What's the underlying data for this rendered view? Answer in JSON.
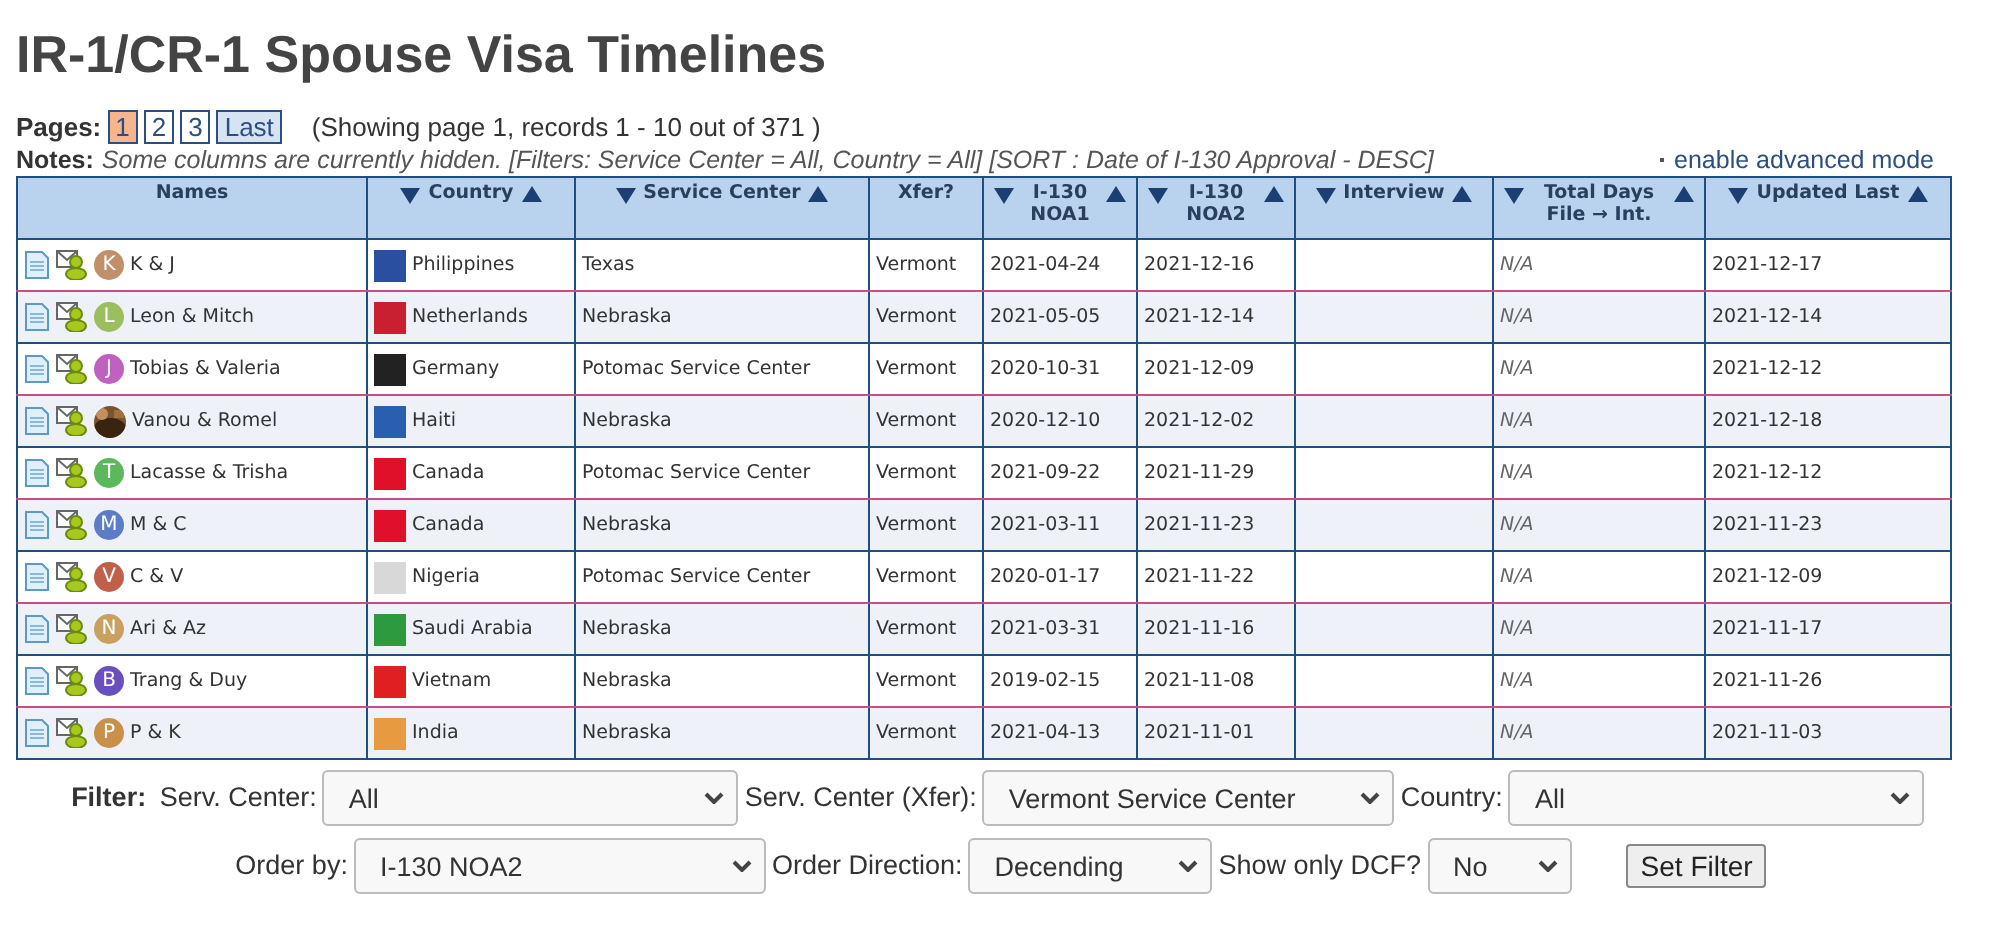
{
  "title": "IR-1/CR-1 Spouse Visa Timelines",
  "pager": {
    "label": "Pages:",
    "pages": [
      {
        "label": "1",
        "selected": true
      },
      {
        "label": "2",
        "selected": false
      },
      {
        "label": "3",
        "selected": false
      },
      {
        "label": "Last",
        "selected": false
      }
    ],
    "summary": "(Showing page 1, records 1 - 10 out of 371 )"
  },
  "notes": {
    "label": "Notes:",
    "text": "Some columns are currently hidden. [Filters: Service Center = All, Country = All] [SORT : Date of I-130 Approval - DESC]",
    "link": "enable advanced mode"
  },
  "table": {
    "columns": [
      {
        "label": "Names",
        "kind": "plain"
      },
      {
        "label": "Country",
        "kind": "sortable"
      },
      {
        "label": "Service Center",
        "kind": "sortable"
      },
      {
        "label": "Xfer?",
        "kind": "plain"
      },
      {
        "label": "I-130 NOA1",
        "kind": "sortable"
      },
      {
        "label": "I-130 NOA2",
        "kind": "sortable"
      },
      {
        "label": "Interview",
        "kind": "sortable"
      },
      {
        "label": "Total Days File → Int.",
        "kind": "sortable"
      },
      {
        "label": "Updated Last",
        "kind": "sortable"
      }
    ],
    "rows": [
      {
        "avatar": {
          "kind": "letter",
          "letter": "K",
          "color": "#c0906a"
        },
        "names": "K & J",
        "flag": {
          "color": "#2a4fa0"
        },
        "country": "Philippines",
        "service_center": "Texas",
        "xfer": "Vermont",
        "noa1": "2021-04-24",
        "noa2": "2021-12-16",
        "total_days": "N/A",
        "updated": "2021-12-17"
      },
      {
        "avatar": {
          "kind": "letter",
          "letter": "L",
          "color": "#9cbf5e"
        },
        "names": "Leon & Mitch",
        "flag": {
          "color": "#c8202f"
        },
        "country": "Netherlands",
        "service_center": "Nebraska",
        "xfer": "Vermont",
        "noa1": "2021-05-05",
        "noa2": "2021-12-14",
        "total_days": "N/A",
        "updated": "2021-12-14"
      },
      {
        "avatar": {
          "kind": "letter",
          "letter": "J",
          "color": "#c060c0"
        },
        "names": "Tobias & Valeria",
        "flag": {
          "color": "#222222"
        },
        "country": "Germany",
        "service_center": "Potomac Service Center",
        "xfer": "Vermont",
        "noa1": "2020-10-31",
        "noa2": "2021-12-09",
        "total_days": "N/A",
        "updated": "2021-12-12"
      },
      {
        "names": "Vanou & Romel",
        "flag": {
          "color": "#2a5fb0"
        },
        "country": "Haiti",
        "service_center": "Nebraska",
        "xfer": "Vermont",
        "noa1": "2020-12-10",
        "noa2": "2021-12-02",
        "total_days": "N/A",
        "updated": "2021-12-18"
      },
      {
        "avatar": {
          "kind": "letter",
          "letter": "T",
          "color": "#5cb85c"
        },
        "names": "Lacasse & Trisha",
        "flag": {
          "color": "#e0102a"
        },
        "country": "Canada",
        "service_center": "Potomac Service Center",
        "xfer": "Vermont",
        "noa1": "2021-09-22",
        "noa2": "2021-11-29",
        "total_days": "N/A",
        "updated": "2021-12-12"
      },
      {
        "avatar": {
          "kind": "letter",
          "letter": "M",
          "color": "#5b7cc8"
        },
        "names": "M & C",
        "flag": {
          "color": "#e0102a"
        },
        "country": "Canada",
        "service_center": "Nebraska",
        "xfer": "Vermont",
        "noa1": "2021-03-11",
        "noa2": "2021-11-23",
        "total_days": "N/A",
        "updated": "2021-11-23"
      },
      {
        "avatar": {
          "kind": "letter",
          "letter": "V",
          "color": "#c0604a"
        },
        "names": "C & V",
        "flag": {
          "color": "#d8d8d8"
        },
        "country": "Nigeria",
        "service_center": "Potomac Service Center",
        "xfer": "Vermont",
        "noa1": "2020-01-17",
        "noa2": "2021-11-22",
        "total_days": "N/A",
        "updated": "2021-12-09"
      },
      {
        "avatar": {
          "kind": "letter",
          "letter": "N",
          "color": "#c8a060"
        },
        "names": "Ari & Az",
        "flag": {
          "color": "#2e9a40"
        },
        "country": "Saudi Arabia",
        "service_center": "Nebraska",
        "xfer": "Vermont",
        "noa1": "2021-03-31",
        "noa2": "2021-11-16",
        "total_days": "N/A",
        "updated": "2021-11-17"
      },
      {
        "avatar": {
          "kind": "letter",
          "letter": "B",
          "color": "#6a4fc0"
        },
        "names": "Trang & Duy",
        "flag": {
          "color": "#e02020"
        },
        "country": "Vietnam",
        "service_center": "Nebraska",
        "xfer": "Vermont",
        "noa1": "2019-02-15",
        "noa2": "2021-11-08",
        "total_days": "N/A",
        "updated": "2021-11-26"
      },
      {
        "avatar": {
          "kind": "letter",
          "letter": "P",
          "color": "#c8904a"
        },
        "names": "P & K",
        "flag": {
          "color": "#e89a40"
        },
        "country": "India",
        "service_center": "Nebraska",
        "xfer": "Vermont",
        "noa1": "2021-04-13",
        "noa2": "2021-11-01",
        "total_days": "N/A",
        "updated": "2021-11-03"
      }
    ]
  },
  "filter": {
    "label": "Filter:",
    "fields": [
      {
        "label": "Serv. Center:",
        "value": "All"
      },
      {
        "label": "Serv. Center (Xfer):",
        "value": "Vermont Service Center"
      },
      {
        "label": "Country:",
        "value": "All"
      },
      {
        "label": "Order by:",
        "value": "I-130 NOA2"
      },
      {
        "label": "Order Direction:",
        "value": "Decending"
      },
      {
        "label": "Show only DCF?",
        "value": "No"
      }
    ],
    "button": "Set Filter"
  }
}
